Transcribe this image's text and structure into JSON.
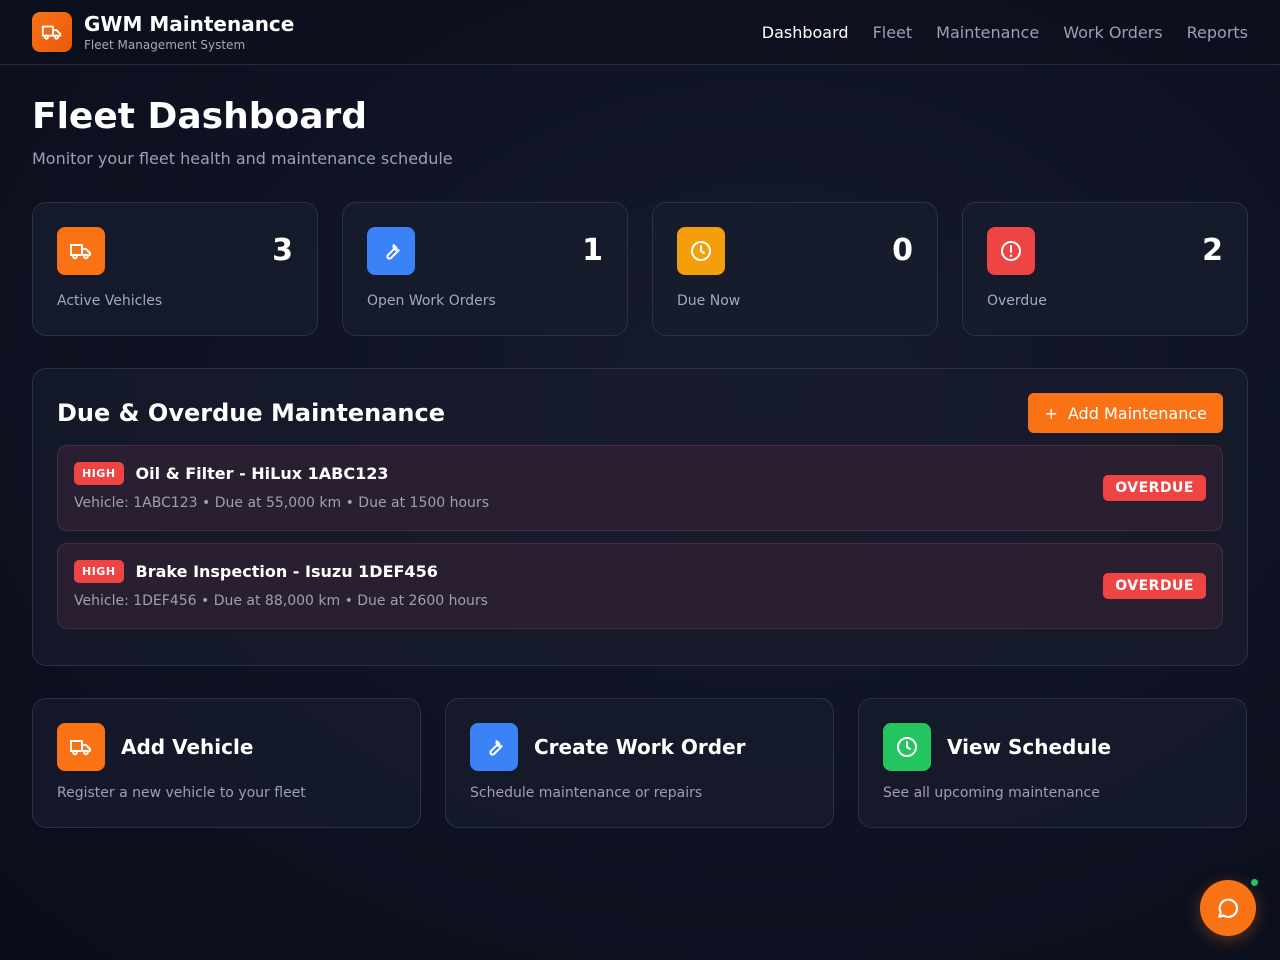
{
  "brand": {
    "name": "GWM Maintenance",
    "subtitle": "Fleet Management System"
  },
  "nav": [
    {
      "label": "Dashboard",
      "active": true
    },
    {
      "label": "Fleet"
    },
    {
      "label": "Maintenance"
    },
    {
      "label": "Work Orders"
    },
    {
      "label": "Reports"
    }
  ],
  "page": {
    "title": "Fleet Dashboard",
    "subtitle": "Monitor your fleet health and maintenance schedule"
  },
  "stats": [
    {
      "value": "3",
      "label": "Active Vehicles",
      "icon": "truck-icon",
      "color": "#f97316"
    },
    {
      "value": "1",
      "label": "Open Work Orders",
      "icon": "wrench-icon",
      "color": "#3b82f6"
    },
    {
      "value": "0",
      "label": "Due Now",
      "icon": "clock-icon",
      "color": "#f59e0b"
    },
    {
      "value": "2",
      "label": "Overdue",
      "icon": "alert-icon",
      "color": "#ef4444"
    }
  ],
  "maintenance": {
    "title": "Due & Overdue Maintenance",
    "add_button": "Add Maintenance",
    "items": [
      {
        "priority": "HIGH",
        "title": "Oil & Filter - HiLux 1ABC123",
        "meta": "Vehicle: 1ABC123 • Due at 55,000 km • Due at 1500 hours",
        "status": "OVERDUE"
      },
      {
        "priority": "HIGH",
        "title": "Brake Inspection - Isuzu 1DEF456",
        "meta": "Vehicle: 1DEF456 • Due at 88,000 km • Due at 2600 hours",
        "status": "OVERDUE"
      }
    ]
  },
  "actions": [
    {
      "title": "Add Vehicle",
      "description": "Register a new vehicle to your fleet",
      "icon": "truck-icon",
      "color": "#f97316"
    },
    {
      "title": "Create Work Order",
      "description": "Schedule maintenance or repairs",
      "icon": "wrench-icon",
      "color": "#3b82f6"
    },
    {
      "title": "View Schedule",
      "description": "See all upcoming maintenance",
      "icon": "clock-icon",
      "color": "#22c55e"
    }
  ],
  "chat": {
    "icon": "chat-icon",
    "online_color": "#22c55e"
  }
}
